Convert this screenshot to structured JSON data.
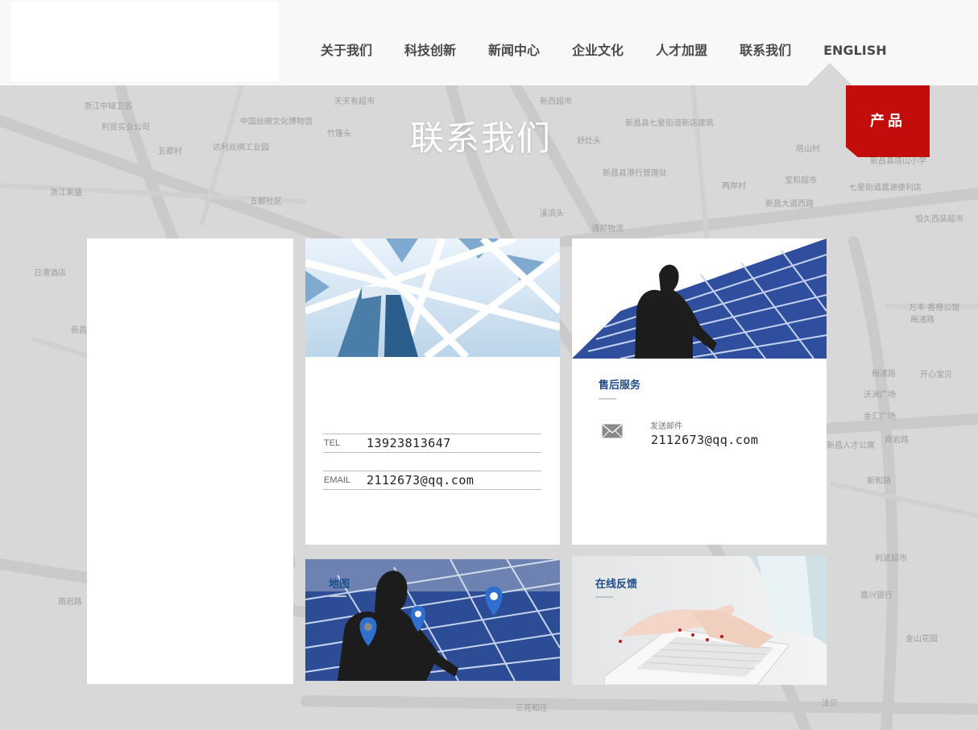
{
  "nav": {
    "items": [
      {
        "label": "关于我们"
      },
      {
        "label": "科技创新"
      },
      {
        "label": "新闻中心"
      },
      {
        "label": "企业文化"
      },
      {
        "label": "人才加盟"
      },
      {
        "label": "联系我们"
      },
      {
        "label": "ENGLISH"
      }
    ]
  },
  "product_tab": "产品",
  "page_title": "联系我们",
  "map_labels": [
    "浙江中域卫浴",
    "利贸实业公司",
    "五都村",
    "达利丝绸工业园",
    "浙江莱盛",
    "天天有超市",
    "竹篷头",
    "新西超市",
    "新昌县七星街道新店建筑",
    "舒灶头",
    "塔山村",
    "新昌县塔山小学",
    "宝和超市",
    "新昌县港行管理处",
    "两岸村",
    "七星街道嘉源便利店",
    "新昌大道西路",
    "溪滨头",
    "通邦物流",
    "恒久西装超市",
    "日港酒店",
    "万丰·香橙公馆",
    "新昌新和",
    "梅渚路",
    "梅渚路",
    "开心宝贝",
    "沃洲广场",
    "金汇广场",
    "新昌人才公寓",
    "南岩路",
    "新和路",
    "利波超市",
    "嘉兴银行",
    "金山花园",
    "三花和庄",
    "法贝",
    "南岩路",
    "五都社区",
    "中国丝绸文化博物馆"
  ],
  "contact": {
    "tel_label": "TEL",
    "tel_value": "13923813647",
    "email_label": "EMAIL",
    "email_value": "2112673@qq.com"
  },
  "service": {
    "title": "售后服务",
    "mail_label": "发送邮件",
    "mail_value": "2112673@qq.com",
    "icon": "mail-icon"
  },
  "map_card": {
    "title": "地图",
    "icon": "location-pin-icon"
  },
  "feedback_card": {
    "title": "在线反馈"
  },
  "colors": {
    "header_bg": "#f8f8f8",
    "page_bg": "#d8d8d8",
    "product_red": "#c30d0d",
    "title_blue": "#1e4d8a",
    "pin_blue": "#2f6fd0"
  }
}
